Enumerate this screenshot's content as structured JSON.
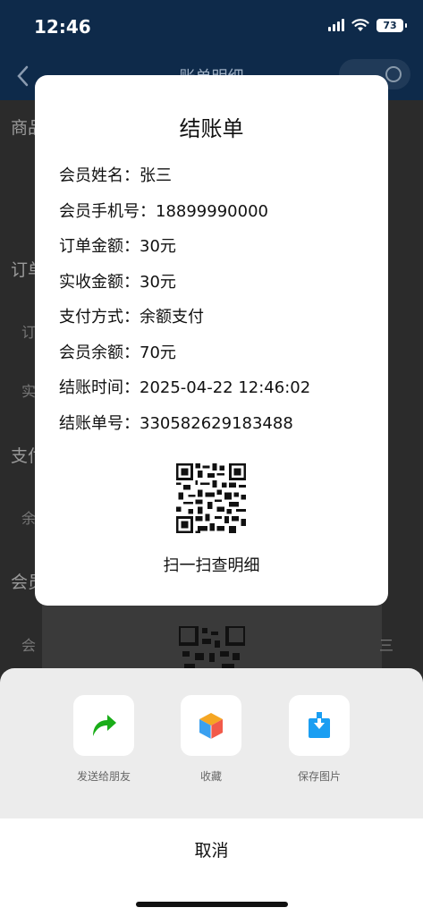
{
  "status_bar": {
    "time": "12:46",
    "battery": "73"
  },
  "nav": {
    "title": "账单明细"
  },
  "background": {
    "labels": [
      "商品",
      "订单",
      "支付",
      "会员"
    ],
    "rows": [
      "订",
      "实",
      "余",
      "会",
      "三"
    ]
  },
  "receipt": {
    "title": "结账单",
    "rows": [
      {
        "label": "会员姓名：",
        "value": "张三"
      },
      {
        "label": "会员手机号：",
        "value": "18899990000"
      },
      {
        "label": "订单金额：",
        "value": "30元"
      },
      {
        "label": "实收金额：",
        "value": "30元"
      },
      {
        "label": "支付方式：",
        "value": "余额支付"
      },
      {
        "label": "会员余额：",
        "value": "70元"
      },
      {
        "label": "结账时间：",
        "value": "2025-04-22 12:46:02"
      },
      {
        "label": "结账单号：",
        "value": "330582629183488"
      }
    ],
    "qr_caption": "扫一扫查明细"
  },
  "share_sheet": {
    "items": [
      {
        "label": "发送给朋友",
        "icon": "share-arrow-icon",
        "color": "#1aad19"
      },
      {
        "label": "收藏",
        "icon": "cube-icon",
        "color": "#f5a623"
      },
      {
        "label": "保存图片",
        "icon": "download-icon",
        "color": "#1a9ef2"
      }
    ],
    "cancel_label": "取消"
  }
}
